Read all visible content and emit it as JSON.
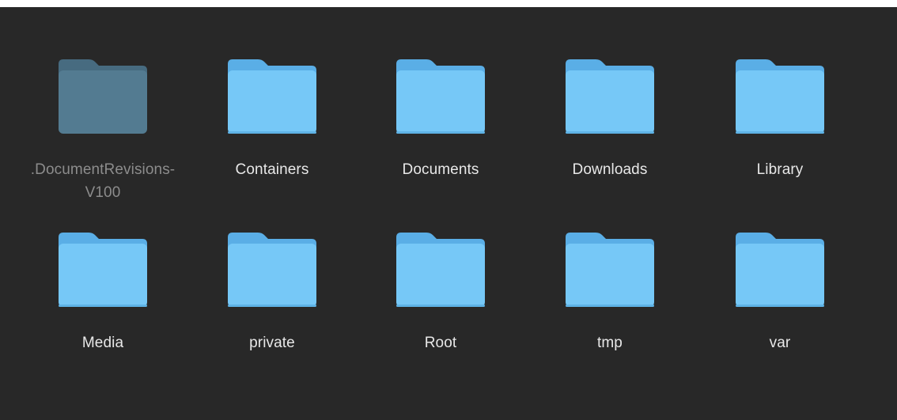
{
  "theme": {
    "background": "#282828",
    "folder_body": "#76c8f7",
    "folder_tab": "#5aaee6",
    "folder_body_hidden": "#537b91",
    "folder_tab_hidden": "#476b80"
  },
  "folders": [
    {
      "label": ".DocumentRevisions-V100",
      "hidden": true,
      "icon": "folder-icon"
    },
    {
      "label": "Containers",
      "hidden": false,
      "icon": "folder-icon"
    },
    {
      "label": "Documents",
      "hidden": false,
      "icon": "folder-icon"
    },
    {
      "label": "Downloads",
      "hidden": false,
      "icon": "folder-icon"
    },
    {
      "label": "Library",
      "hidden": false,
      "icon": "folder-icon"
    },
    {
      "label": "Media",
      "hidden": false,
      "icon": "folder-icon"
    },
    {
      "label": "private",
      "hidden": false,
      "icon": "folder-icon"
    },
    {
      "label": "Root",
      "hidden": false,
      "icon": "folder-icon"
    },
    {
      "label": "tmp",
      "hidden": false,
      "icon": "folder-icon"
    },
    {
      "label": "var",
      "hidden": false,
      "icon": "folder-icon"
    }
  ]
}
